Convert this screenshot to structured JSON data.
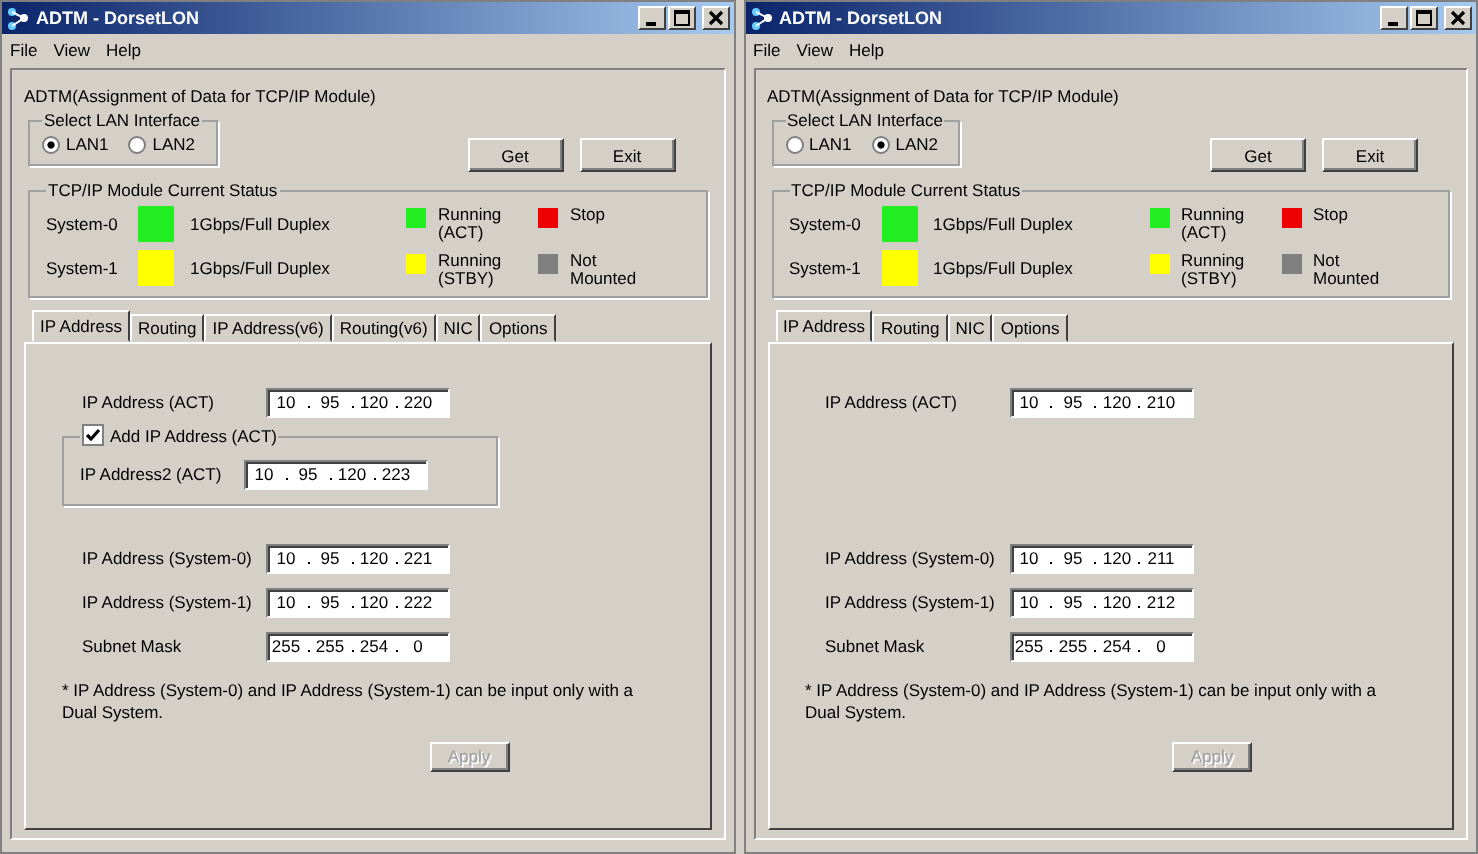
{
  "windows": [
    {
      "title": "ADTM - DorsetLON",
      "menu": [
        "File",
        "View",
        "Help"
      ],
      "heading": "ADTM(Assignment of Data for TCP/IP Module)",
      "lan": {
        "legend": "Select LAN Interface",
        "options": [
          {
            "label": "LAN1",
            "selected": true
          },
          {
            "label": "LAN2",
            "selected": false
          }
        ]
      },
      "buttons": [
        {
          "label": "Get"
        },
        {
          "label": "Exit"
        }
      ],
      "status": {
        "legend": "TCP/IP Module Current Status",
        "systems": [
          {
            "name": "System-0",
            "color": "#22ee22",
            "speed": "1Gbps/Full Duplex"
          },
          {
            "name": "System-1",
            "color": "#ffff00",
            "speed": "1Gbps/Full Duplex"
          }
        ],
        "legend_items": [
          {
            "label": "Running (ACT)",
            "color": "#22ee22"
          },
          {
            "label": "Stop",
            "color": "#ee0000"
          },
          {
            "label": "Running (STBY)",
            "color": "#ffff00"
          },
          {
            "label": "Not Mounted",
            "color": "#808080"
          }
        ]
      },
      "tabs": [
        {
          "label": "IP Address",
          "selected": true
        },
        {
          "label": "Routing",
          "selected": false
        },
        {
          "label": "IP Address(v6)",
          "selected": false
        },
        {
          "label": "Routing(v6)",
          "selected": false
        },
        {
          "label": "NIC",
          "selected": false
        },
        {
          "label": "Options",
          "selected": false
        }
      ],
      "act": {
        "label": "IP Address (ACT)",
        "octets": [
          "10",
          "95",
          "120",
          "220"
        ]
      },
      "add_ip": {
        "label": "Add IP Address (ACT)",
        "checked": true,
        "field": {
          "label": "IP Address2 (ACT)",
          "octets": [
            "10",
            "95",
            "120",
            "223"
          ]
        }
      },
      "fields": [
        {
          "label": "IP Address (System-0)",
          "octets": [
            "10",
            "95",
            "120",
            "221"
          ]
        },
        {
          "label": "IP Address (System-1)",
          "octets": [
            "10",
            "95",
            "120",
            "222"
          ]
        },
        {
          "label": "Subnet Mask",
          "octets": [
            "255",
            "255",
            "254",
            "0"
          ]
        }
      ],
      "note": "* IP Address (System-0) and IP Address (System-1) can be input only with a Dual System.",
      "apply": {
        "label": "Apply",
        "disabled": true
      }
    },
    {
      "title": "ADTM - DorsetLON",
      "menu": [
        "File",
        "View",
        "Help"
      ],
      "heading": "ADTM(Assignment of Data for TCP/IP Module)",
      "lan": {
        "legend": "Select LAN Interface",
        "options": [
          {
            "label": "LAN1",
            "selected": false
          },
          {
            "label": "LAN2",
            "selected": true
          }
        ]
      },
      "buttons": [
        {
          "label": "Get"
        },
        {
          "label": "Exit"
        }
      ],
      "status": {
        "legend": "TCP/IP Module Current Status",
        "systems": [
          {
            "name": "System-0",
            "color": "#22ee22",
            "speed": "1Gbps/Full Duplex"
          },
          {
            "name": "System-1",
            "color": "#ffff00",
            "speed": "1Gbps/Full Duplex"
          }
        ],
        "legend_items": [
          {
            "label": "Running (ACT)",
            "color": "#22ee22"
          },
          {
            "label": "Stop",
            "color": "#ee0000"
          },
          {
            "label": "Running (STBY)",
            "color": "#ffff00"
          },
          {
            "label": "Not Mounted",
            "color": "#808080"
          }
        ]
      },
      "tabs": [
        {
          "label": "IP Address",
          "selected": true
        },
        {
          "label": "Routing",
          "selected": false
        },
        {
          "label": "NIC",
          "selected": false
        },
        {
          "label": "Options",
          "selected": false
        }
      ],
      "act": {
        "label": "IP Address (ACT)",
        "octets": [
          "10",
          "95",
          "120",
          "210"
        ]
      },
      "fields": [
        {
          "label": "IP Address (System-0)",
          "octets": [
            "10",
            "95",
            "120",
            "211"
          ]
        },
        {
          "label": "IP Address (System-1)",
          "octets": [
            "10",
            "95",
            "120",
            "212"
          ]
        },
        {
          "label": "Subnet Mask",
          "octets": [
            "255",
            "255",
            "254",
            "0"
          ]
        }
      ],
      "note": "* IP Address (System-0) and IP Address (System-1) can be input only with a Dual System.",
      "apply": {
        "label": "Apply",
        "disabled": true
      }
    }
  ]
}
